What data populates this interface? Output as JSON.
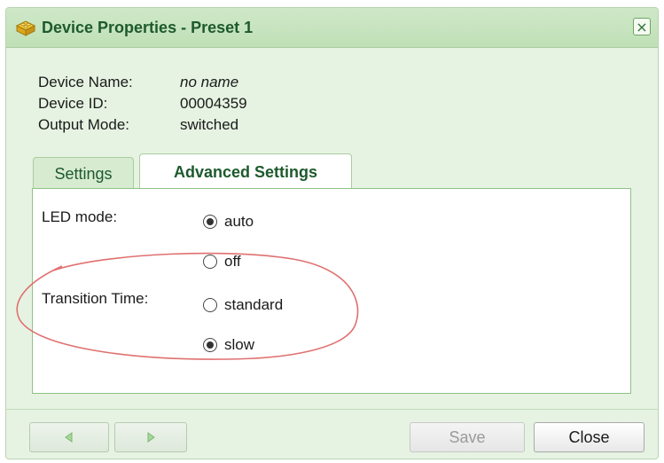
{
  "window": {
    "title": "Device Properties - Preset 1",
    "close_glyph": "×"
  },
  "device_info": {
    "name_label": "Device Name:",
    "name_value": "no name",
    "id_label": "Device ID:",
    "id_value": "00004359",
    "mode_label": "Output Mode:",
    "mode_value": "switched"
  },
  "tabs": [
    {
      "label": "Settings",
      "active": false
    },
    {
      "label": "Advanced Settings",
      "active": true
    }
  ],
  "advanced": {
    "led_mode": {
      "label": "LED mode:",
      "options": [
        {
          "label": "auto",
          "checked": true
        },
        {
          "label": "off",
          "checked": false
        }
      ]
    },
    "transition_time": {
      "label": "Transition Time:",
      "options": [
        {
          "label": "standard",
          "checked": false
        },
        {
          "label": "slow",
          "checked": true
        }
      ]
    }
  },
  "footer": {
    "prev_icon": "arrow-left-icon",
    "next_icon": "arrow-right-icon",
    "save_label": "Save",
    "save_disabled": true,
    "close_label": "Close"
  },
  "colors": {
    "accent": "#1d5a2c",
    "dialog_bg": "#e6f3e2",
    "annotation": "#e07070"
  }
}
